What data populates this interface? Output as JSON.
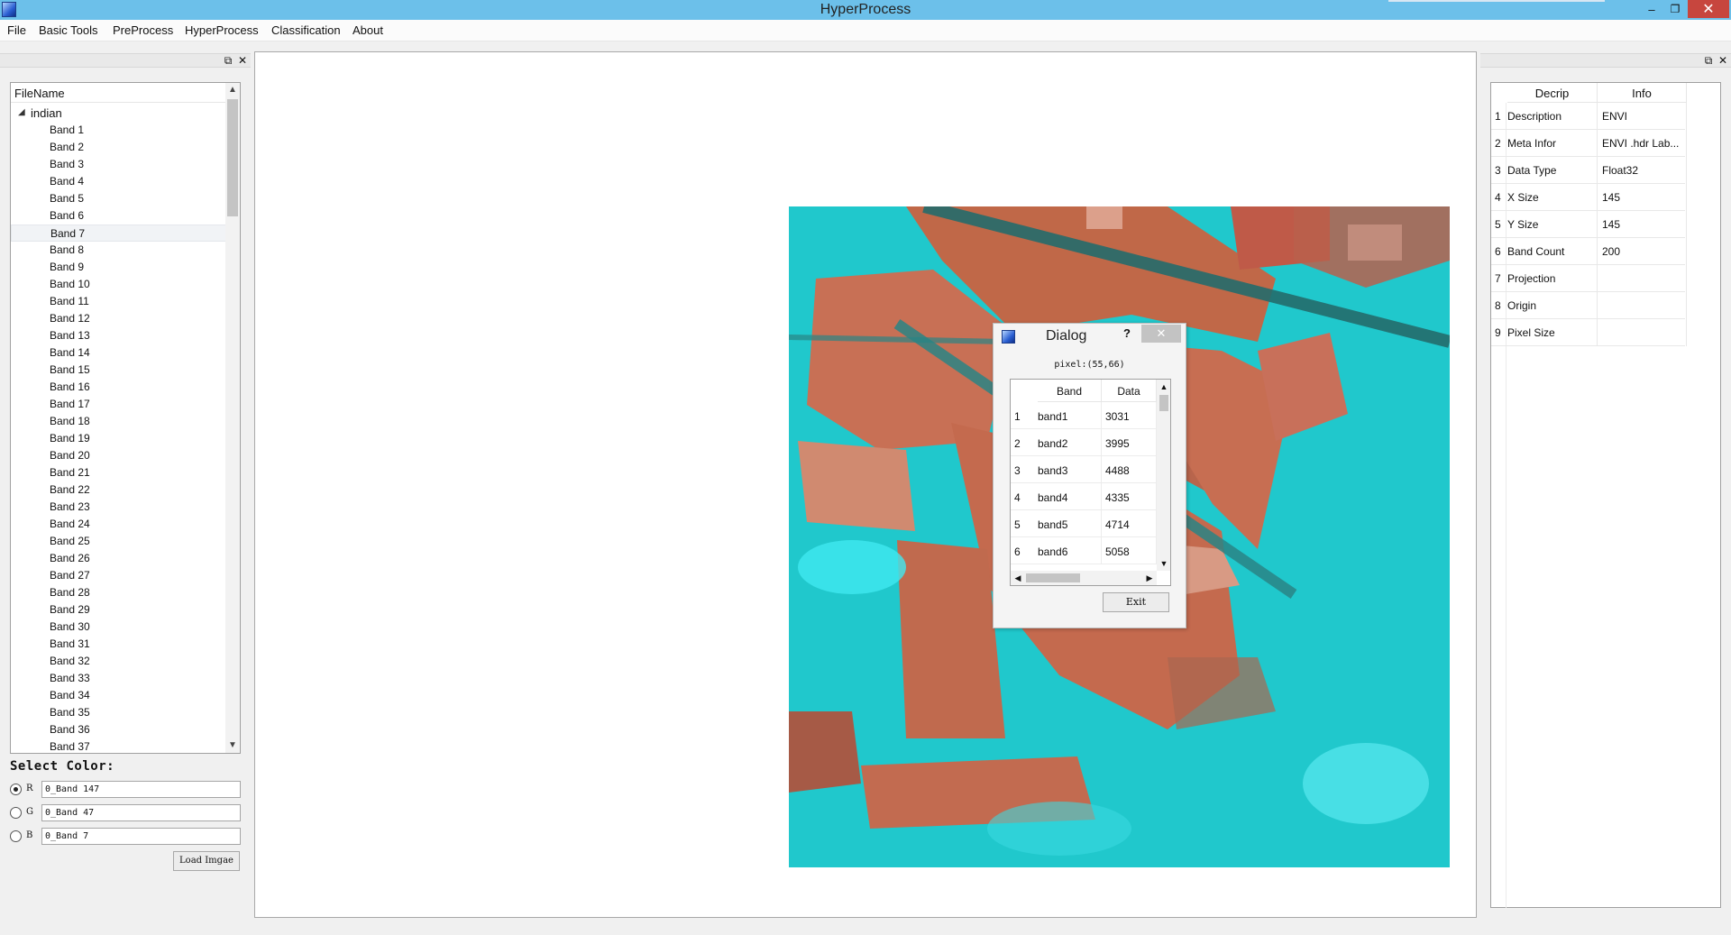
{
  "window": {
    "title": "HyperProcess",
    "minimize": "–",
    "maximize": "❐",
    "close": "✕"
  },
  "menu": [
    "File",
    "Basic Tools",
    "PreProcess",
    "HyperProcess",
    "Classification",
    "About"
  ],
  "left_dock": {
    "tree_header": "FileName",
    "root": "indian",
    "bands": [
      "Band 1",
      "Band 2",
      "Band 3",
      "Band 4",
      "Band 5",
      "Band 6",
      "Band 7",
      "Band 8",
      "Band 9",
      "Band 10",
      "Band 11",
      "Band 12",
      "Band 13",
      "Band 14",
      "Band 15",
      "Band 16",
      "Band 17",
      "Band 18",
      "Band 19",
      "Band 20",
      "Band 21",
      "Band 22",
      "Band 23",
      "Band 24",
      "Band 25",
      "Band 26",
      "Band 27",
      "Band 28",
      "Band 29",
      "Band 30",
      "Band 31",
      "Band 32",
      "Band 33",
      "Band 34",
      "Band 35",
      "Band 36",
      "Band 37"
    ],
    "highlighted_band": "Band 7",
    "select_color_label": "Select Color:",
    "rgb": [
      {
        "letter": "R",
        "value": "0_Band 147",
        "checked": true
      },
      {
        "letter": "G",
        "value": "0_Band 47",
        "checked": false
      },
      {
        "letter": "B",
        "value": "0_Band 7",
        "checked": false
      }
    ],
    "load_button": "Load Imgae"
  },
  "info_panel": {
    "headers": [
      "Decrip",
      "Info"
    ],
    "rows": [
      {
        "n": "1",
        "key": "Description",
        "val": "ENVI"
      },
      {
        "n": "2",
        "key": "Meta Infor",
        "val": "ENVI .hdr Lab..."
      },
      {
        "n": "3",
        "key": "Data Type",
        "val": "Float32"
      },
      {
        "n": "4",
        "key": "X Size",
        "val": "145"
      },
      {
        "n": "5",
        "key": "Y Size",
        "val": "145"
      },
      {
        "n": "6",
        "key": "Band Count",
        "val": "200"
      },
      {
        "n": "7",
        "key": "Projection",
        "val": ""
      },
      {
        "n": "8",
        "key": "Origin",
        "val": ""
      },
      {
        "n": "9",
        "key": "Pixel Size",
        "val": ""
      }
    ]
  },
  "dialog": {
    "title": "Dialog",
    "help": "?",
    "close": "✕",
    "pixel": "pixel:(55,66)",
    "headers": [
      "Band",
      "Data"
    ],
    "rows": [
      {
        "n": "1",
        "band": "band1",
        "data": "3031"
      },
      {
        "n": "2",
        "band": "band2",
        "data": "3995"
      },
      {
        "n": "3",
        "band": "band3",
        "data": "4488"
      },
      {
        "n": "4",
        "band": "band4",
        "data": "4335"
      },
      {
        "n": "5",
        "band": "band5",
        "data": "4714"
      },
      {
        "n": "6",
        "band": "band6",
        "data": "5058"
      }
    ],
    "exit_button": "Exit"
  },
  "colors": {
    "titlebar": "#6cc0ea",
    "vegetation_cyan": "#20c8cc",
    "field_red": "#c06848"
  }
}
